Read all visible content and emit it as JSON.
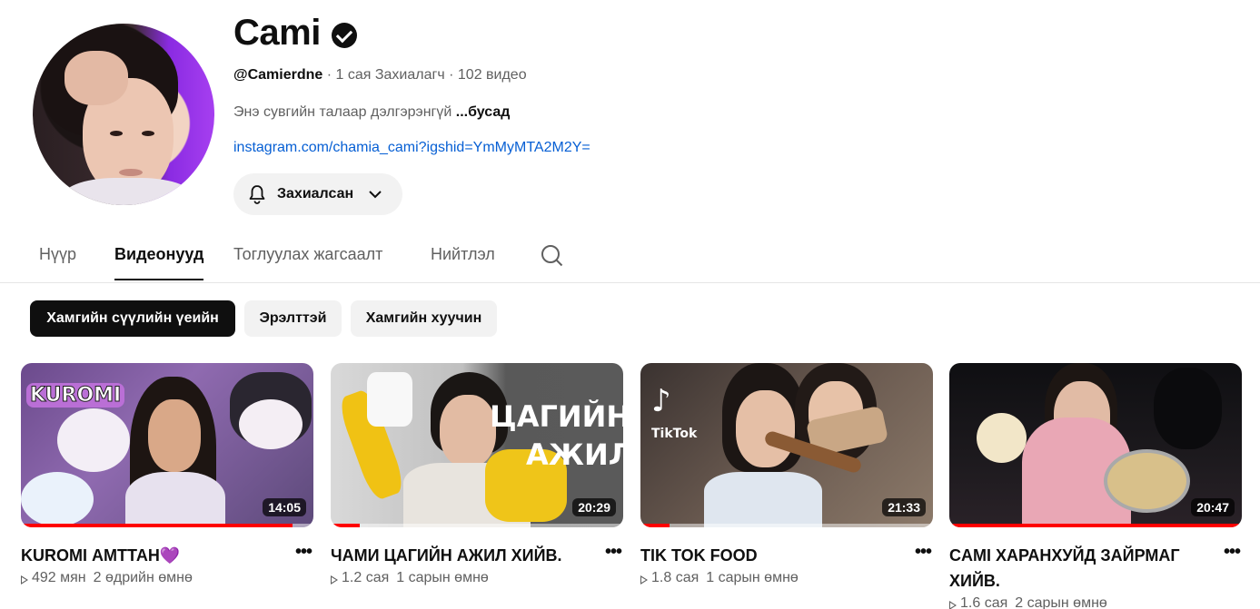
{
  "channel": {
    "name": "Cami",
    "handle": "@Camierdne",
    "stats": " · 1 сая Захиалагч · 102 видео",
    "description": "Энэ сувгийн талаар дэлгэрэнгүй ",
    "more_label": "...бусад",
    "link": "instagram.com/chamia_cami?igshid=YmMyMTA2M2Y=",
    "subscribe_label": "Захиалсан"
  },
  "tabs": [
    {
      "label": "Нүүр"
    },
    {
      "label": "Видеонууд"
    },
    {
      "label": "Тоглуулах жагсаалт"
    },
    {
      "label": "Нийтлэл"
    }
  ],
  "chips": [
    {
      "label": "Хамгийн сүүлийн үеийн"
    },
    {
      "label": "Эрэлттэй"
    },
    {
      "label": "Хамгийн хуучин"
    }
  ],
  "videos": [
    {
      "title": "KUROMI АМТТАН💜",
      "duration": "14:05",
      "views": "492 мян",
      "age": "2 өдрийн өмнө",
      "thumb_text": "KUROMI",
      "progress": 0.93
    },
    {
      "title": "ЧАМИ ЦАГИЙН АЖИЛ ХИЙВ.",
      "duration": "20:29",
      "views": "1.2 сая",
      "age": "1 сарын өмнө",
      "thumb_text_1": "ЦАГИЙН",
      "thumb_text_2": "АЖИЛ",
      "progress": 0.1
    },
    {
      "title": "TIK TOK FOOD",
      "duration": "21:33",
      "views": "1.8 сая",
      "age": "1 сарын өмнө",
      "thumb_text": "TikTok",
      "progress": 0.1
    },
    {
      "title": "CAMI ХАРАНХУЙД ЗАЙРМАГ ХИЙВ.",
      "duration": "20:47",
      "views": "1.6 сая",
      "age": "2 сарын өмнө",
      "progress": 1.0
    }
  ],
  "colors": {
    "accent": "#ff0000",
    "link": "#065fd4",
    "verified": "#0f0f0f"
  }
}
